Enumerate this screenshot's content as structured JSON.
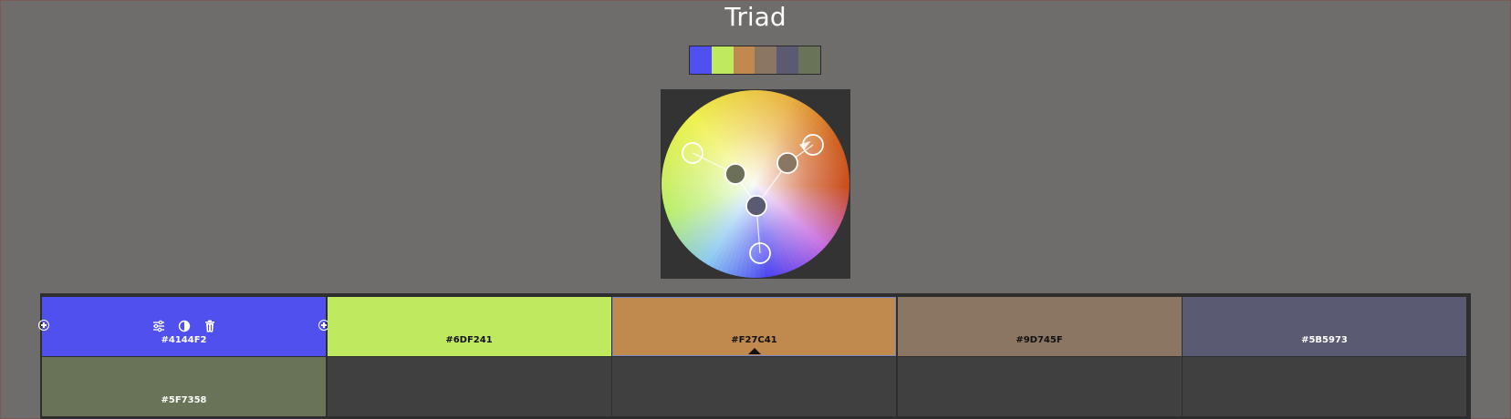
{
  "header": {
    "title": "Triad"
  },
  "palette": {
    "colors": [
      {
        "hex": "#4144F2",
        "swatch": "#4f50ee",
        "text_color": "#ffffff"
      },
      {
        "hex": "#6DF241",
        "swatch": "#bfe95f",
        "text_color": "#111111"
      },
      {
        "hex": "#F27C41",
        "swatch": "#c0894e",
        "text_color": "#111111"
      },
      {
        "hex": "#9D745F",
        "swatch": "#8a7662",
        "text_color": "#111111"
      },
      {
        "hex": "#5B5973",
        "swatch": "#5a5a73",
        "text_color": "#ffffff"
      },
      {
        "hex": "#5F7358",
        "swatch": "#687357",
        "text_color": "#ffffff"
      }
    ],
    "selected_index": 2,
    "active_index": 0
  },
  "toolbar": {
    "icons": [
      "sliders-icon",
      "contrast-icon",
      "trash-icon"
    ],
    "add_icon": "plus-circle-icon"
  },
  "wheel": {
    "handle_fills": [
      "none",
      "#6b7056",
      "#8a7662",
      "none",
      "#5a5a73",
      "none"
    ]
  },
  "colors": {
    "background": "#6f6d6b",
    "panel": "#333333",
    "empty_cell": "#404040"
  }
}
